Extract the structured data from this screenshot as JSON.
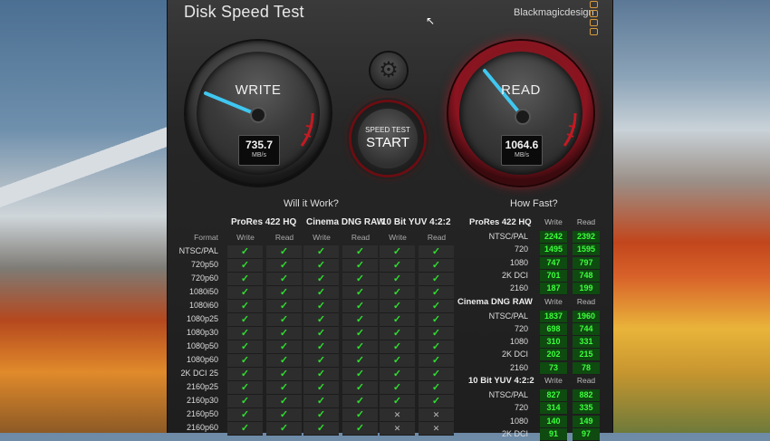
{
  "app": {
    "title": "Disk Speed Test",
    "brand": "Blackmagicdesign"
  },
  "gauges": {
    "write": {
      "label": "WRITE",
      "value": "735.7",
      "unit": "MB/s"
    },
    "read": {
      "label": "READ",
      "value": "1064.6",
      "unit": "MB/s"
    }
  },
  "start_button": {
    "top": "SPEED TEST",
    "main": "START"
  },
  "icons": {
    "settings": "gear-icon",
    "check": "✓",
    "cross": "✕"
  },
  "colors": {
    "ok": "#2ee02e",
    "speed_bg": "#0f4a10",
    "accent_red": "#a01822"
  },
  "will_it_work": {
    "title": "Will it Work?",
    "format_header": "Format",
    "groups": [
      {
        "name": "ProRes 422 HQ",
        "write": "Write",
        "read": "Read"
      },
      {
        "name": "Cinema DNG RAW",
        "write": "Write",
        "read": "Read"
      },
      {
        "name": "10 Bit YUV 4:2:2",
        "write": "Write",
        "read": "Read"
      }
    ],
    "rows": [
      {
        "format": "NTSC/PAL",
        "cells": [
          1,
          1,
          1,
          1,
          1,
          1
        ]
      },
      {
        "format": "720p50",
        "cells": [
          1,
          1,
          1,
          1,
          1,
          1
        ]
      },
      {
        "format": "720p60",
        "cells": [
          1,
          1,
          1,
          1,
          1,
          1
        ]
      },
      {
        "format": "1080i50",
        "cells": [
          1,
          1,
          1,
          1,
          1,
          1
        ]
      },
      {
        "format": "1080i60",
        "cells": [
          1,
          1,
          1,
          1,
          1,
          1
        ]
      },
      {
        "format": "1080p25",
        "cells": [
          1,
          1,
          1,
          1,
          1,
          1
        ]
      },
      {
        "format": "1080p30",
        "cells": [
          1,
          1,
          1,
          1,
          1,
          1
        ]
      },
      {
        "format": "1080p50",
        "cells": [
          1,
          1,
          1,
          1,
          1,
          1
        ]
      },
      {
        "format": "1080p60",
        "cells": [
          1,
          1,
          1,
          1,
          1,
          1
        ]
      },
      {
        "format": "2K DCI 25",
        "cells": [
          1,
          1,
          1,
          1,
          1,
          1
        ]
      },
      {
        "format": "2160p25",
        "cells": [
          1,
          1,
          1,
          1,
          1,
          1
        ]
      },
      {
        "format": "2160p30",
        "cells": [
          1,
          1,
          1,
          1,
          1,
          1
        ]
      },
      {
        "format": "2160p50",
        "cells": [
          1,
          1,
          1,
          1,
          0,
          0
        ]
      },
      {
        "format": "2160p60",
        "cells": [
          1,
          1,
          1,
          1,
          0,
          0
        ]
      }
    ]
  },
  "how_fast": {
    "title": "How Fast?",
    "write_header": "Write",
    "read_header": "Read",
    "groups": [
      {
        "name": "ProRes 422 HQ",
        "rows": [
          {
            "format": "NTSC/PAL",
            "write": "2242",
            "read": "2392"
          },
          {
            "format": "720",
            "write": "1495",
            "read": "1595"
          },
          {
            "format": "1080",
            "write": "747",
            "read": "797"
          },
          {
            "format": "2K DCI",
            "write": "701",
            "read": "748"
          },
          {
            "format": "2160",
            "write": "187",
            "read": "199"
          }
        ]
      },
      {
        "name": "Cinema DNG RAW",
        "rows": [
          {
            "format": "NTSC/PAL",
            "write": "1837",
            "read": "1960"
          },
          {
            "format": "720",
            "write": "698",
            "read": "744"
          },
          {
            "format": "1080",
            "write": "310",
            "read": "331"
          },
          {
            "format": "2K DCI",
            "write": "202",
            "read": "215"
          },
          {
            "format": "2160",
            "write": "73",
            "read": "78"
          }
        ]
      },
      {
        "name": "10 Bit YUV 4:2:2",
        "rows": [
          {
            "format": "NTSC/PAL",
            "write": "827",
            "read": "882"
          },
          {
            "format": "720",
            "write": "314",
            "read": "335"
          },
          {
            "format": "1080",
            "write": "140",
            "read": "149"
          },
          {
            "format": "2K DCI",
            "write": "91",
            "read": "97"
          }
        ]
      }
    ]
  }
}
